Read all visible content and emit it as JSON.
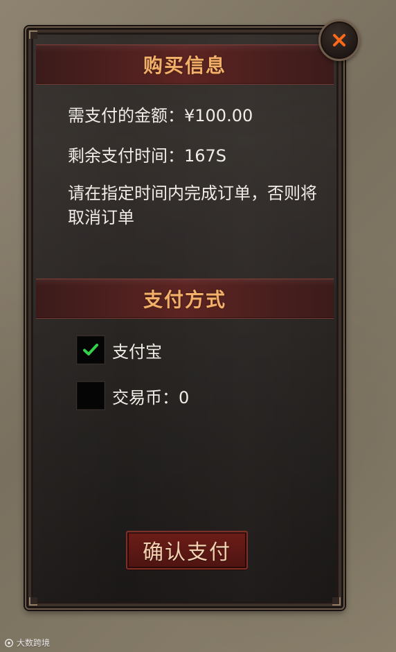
{
  "dialog": {
    "section_one_title": "购买信息",
    "amount_label": "需支付的金额：¥100.00",
    "time_label": "剩余支付时间：167S",
    "notice_text": "请在指定时间内完成订单，否则将取消订单",
    "section_two_title": "支付方式",
    "payment_options": [
      {
        "label": "支付宝",
        "checked": true
      },
      {
        "label": "交易币：0",
        "checked": false
      }
    ],
    "confirm_label": "确认支付",
    "colors": {
      "accent": "#f2b06b",
      "check": "#34d14b",
      "close": "#ff6a1a"
    }
  },
  "icons": {
    "close": "close-icon",
    "check": "check-icon",
    "watermark": "watermark-logo"
  },
  "watermark": {
    "text": "大数跨境"
  }
}
